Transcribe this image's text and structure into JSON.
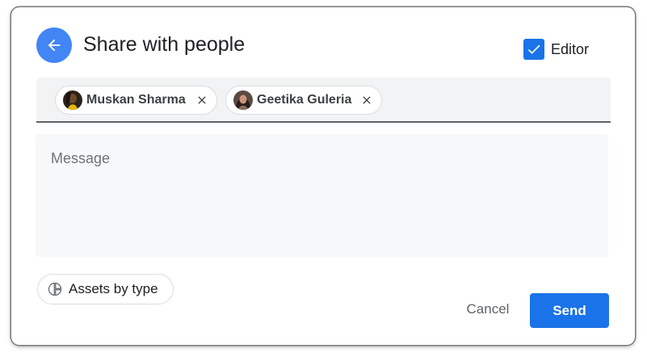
{
  "dialog": {
    "title": "Share with people",
    "back_icon": "arrow-back-icon",
    "editor": {
      "label": "Editor",
      "checked": true
    }
  },
  "recipients": [
    {
      "name": "Muskan Sharma",
      "avatar_icon": "user-avatar",
      "remove_icon": "close-icon"
    },
    {
      "name": "Geetika Guleria",
      "avatar_icon": "user-avatar",
      "remove_icon": "close-icon"
    }
  ],
  "message": {
    "placeholder": "Message",
    "value": ""
  },
  "assets_chip": {
    "label": "Assets by type",
    "icon": "pie-chart-icon"
  },
  "actions": {
    "cancel_label": "Cancel",
    "send_label": "Send"
  },
  "colors": {
    "accent": "#1a73e8",
    "back_button": "#4285f4",
    "recipients_bg": "#f1f3f4",
    "message_bg": "#f7f8f9"
  }
}
